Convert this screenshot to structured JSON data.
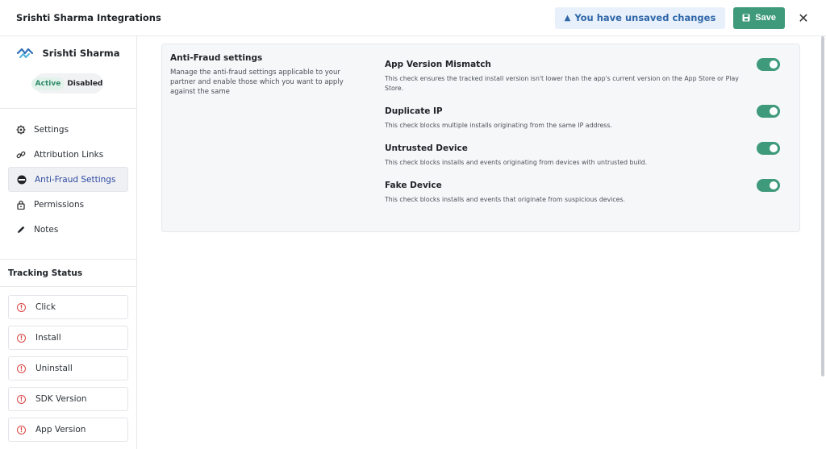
{
  "header": {
    "title": "Srishti Sharma Integrations",
    "unsaved_text": "You have unsaved changes",
    "save_label": "Save"
  },
  "profile": {
    "name": "Srishti Sharma",
    "status_active": "Active",
    "status_disabled": "Disabled"
  },
  "nav": {
    "items": [
      {
        "label": "Settings",
        "icon": "gear-icon"
      },
      {
        "label": "Attribution Links",
        "icon": "link-icon"
      },
      {
        "label": "Anti-Fraud Settings",
        "icon": "shield-icon",
        "selected": true
      },
      {
        "label": "Permissions",
        "icon": "lock-icon"
      },
      {
        "label": "Notes",
        "icon": "pencil-icon"
      }
    ]
  },
  "tracking": {
    "title": "Tracking Status",
    "items": [
      "Click",
      "Install",
      "Uninstall",
      "SDK Version",
      "App Version"
    ]
  },
  "anti_fraud": {
    "heading": "Anti-Fraud settings",
    "description": "Manage the anti-fraud settings applicable to your partner and enable those which you want to apply against the same",
    "checks": [
      {
        "title": "App Version Mismatch",
        "desc": "This check ensures the tracked install version isn't lower than the app's current version on the App Store or Play Store.",
        "enabled": true
      },
      {
        "title": "Duplicate IP",
        "desc": "This check blocks multiple installs originating from the same IP address.",
        "enabled": true
      },
      {
        "title": "Untrusted Device",
        "desc": "This check blocks installs and events originating from devices with untrusted build.",
        "enabled": true
      },
      {
        "title": "Fake Device",
        "desc": "This check blocks installs and events that originate from suspicious devices.",
        "enabled": true
      }
    ]
  },
  "colors": {
    "accent": "#3e9a7a",
    "selected_nav_text": "#2f4aa0",
    "warning": "#dd4444"
  }
}
